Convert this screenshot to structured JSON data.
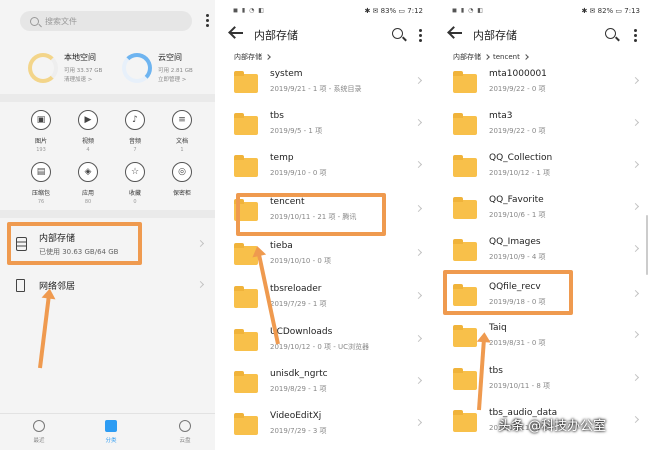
{
  "panel1": {
    "search_placeholder": "搜索文件",
    "local_storage": {
      "title": "本地空间",
      "detail": "可用 33.37 GB",
      "action": "清理加速 >"
    },
    "cloud_storage": {
      "title": "云空间",
      "detail": "可用 2.81 GB",
      "action": "立即管理 >"
    },
    "categories": [
      {
        "label": "图片",
        "count": "193",
        "icon": "image-icon"
      },
      {
        "label": "视频",
        "count": "4",
        "icon": "video-icon"
      },
      {
        "label": "音频",
        "count": "7",
        "icon": "music-icon"
      },
      {
        "label": "文档",
        "count": "1",
        "icon": "document-icon"
      },
      {
        "label": "压缩包",
        "count": "76",
        "icon": "archive-icon"
      },
      {
        "label": "应用",
        "count": "80",
        "icon": "app-icon"
      },
      {
        "label": "收藏",
        "count": "0",
        "icon": "star-icon"
      },
      {
        "label": "保密柜",
        "count": "",
        "icon": "safe-icon"
      }
    ],
    "internal": {
      "title": "内部存储",
      "detail": "已使用 30.63 GB/64 GB"
    },
    "network": {
      "title": "网络邻居"
    },
    "nav": [
      {
        "label": "最近",
        "icon": "clock-icon"
      },
      {
        "label": "分类",
        "icon": "folder-icon"
      },
      {
        "label": "云盘",
        "icon": "cloud-icon"
      }
    ],
    "accent": "#2d9cf3"
  },
  "panel2": {
    "status_left": "◼ ▮ ◔ ◧",
    "status_right": "✱ ✉ 83% ▭ 7:12",
    "title": "内部存储",
    "breadcrumb": [
      "内部存储"
    ],
    "folders": [
      {
        "name": "system",
        "meta": "2019/9/21 - 1 项 - 系统目录"
      },
      {
        "name": "tbs",
        "meta": "2019/9/5 - 1 项"
      },
      {
        "name": "temp",
        "meta": "2019/9/10 - 0 项"
      },
      {
        "name": "tencent",
        "meta": "2019/10/11 - 21 项 - 腾讯"
      },
      {
        "name": "tieba",
        "meta": "2019/10/10 - 0 项"
      },
      {
        "name": "tbsreloader",
        "meta": "2019/7/29 - 1 项"
      },
      {
        "name": "UCDownloads",
        "meta": "2019/10/12 - 0 项 - UC浏览器"
      },
      {
        "name": "unisdk_ngrtc",
        "meta": "2019/8/29 - 1 项"
      },
      {
        "name": "VideoEditXj",
        "meta": "2019/7/29 - 3 项"
      }
    ]
  },
  "panel3": {
    "status_left": "◼ ▮ ◔ ◧",
    "status_right": "✱ ✉ 82% ▭ 7:13",
    "title": "内部存储",
    "breadcrumb": [
      "内部存储",
      "tencent"
    ],
    "folders": [
      {
        "name": "mta1000001",
        "meta": "2019/9/22 - 0 项"
      },
      {
        "name": "mta3",
        "meta": "2019/9/22 - 0 项"
      },
      {
        "name": "QQ_Collection",
        "meta": "2019/10/12 - 1 项"
      },
      {
        "name": "QQ_Favorite",
        "meta": "2019/10/6 - 1 项"
      },
      {
        "name": "QQ_Images",
        "meta": "2019/10/9 - 4 项"
      },
      {
        "name": "QQfile_recv",
        "meta": "2019/9/18 - 0 项"
      },
      {
        "name": "Taiq",
        "meta": "2019/8/31 - 0 项"
      },
      {
        "name": "tbs",
        "meta": "2019/10/11 - 8 项"
      },
      {
        "name": "tbs_audio_data",
        "meta": "2019/10/11 - 1 项"
      }
    ]
  },
  "highlight_color": "#ef9a4f",
  "watermark": "头条 @科技办公室"
}
